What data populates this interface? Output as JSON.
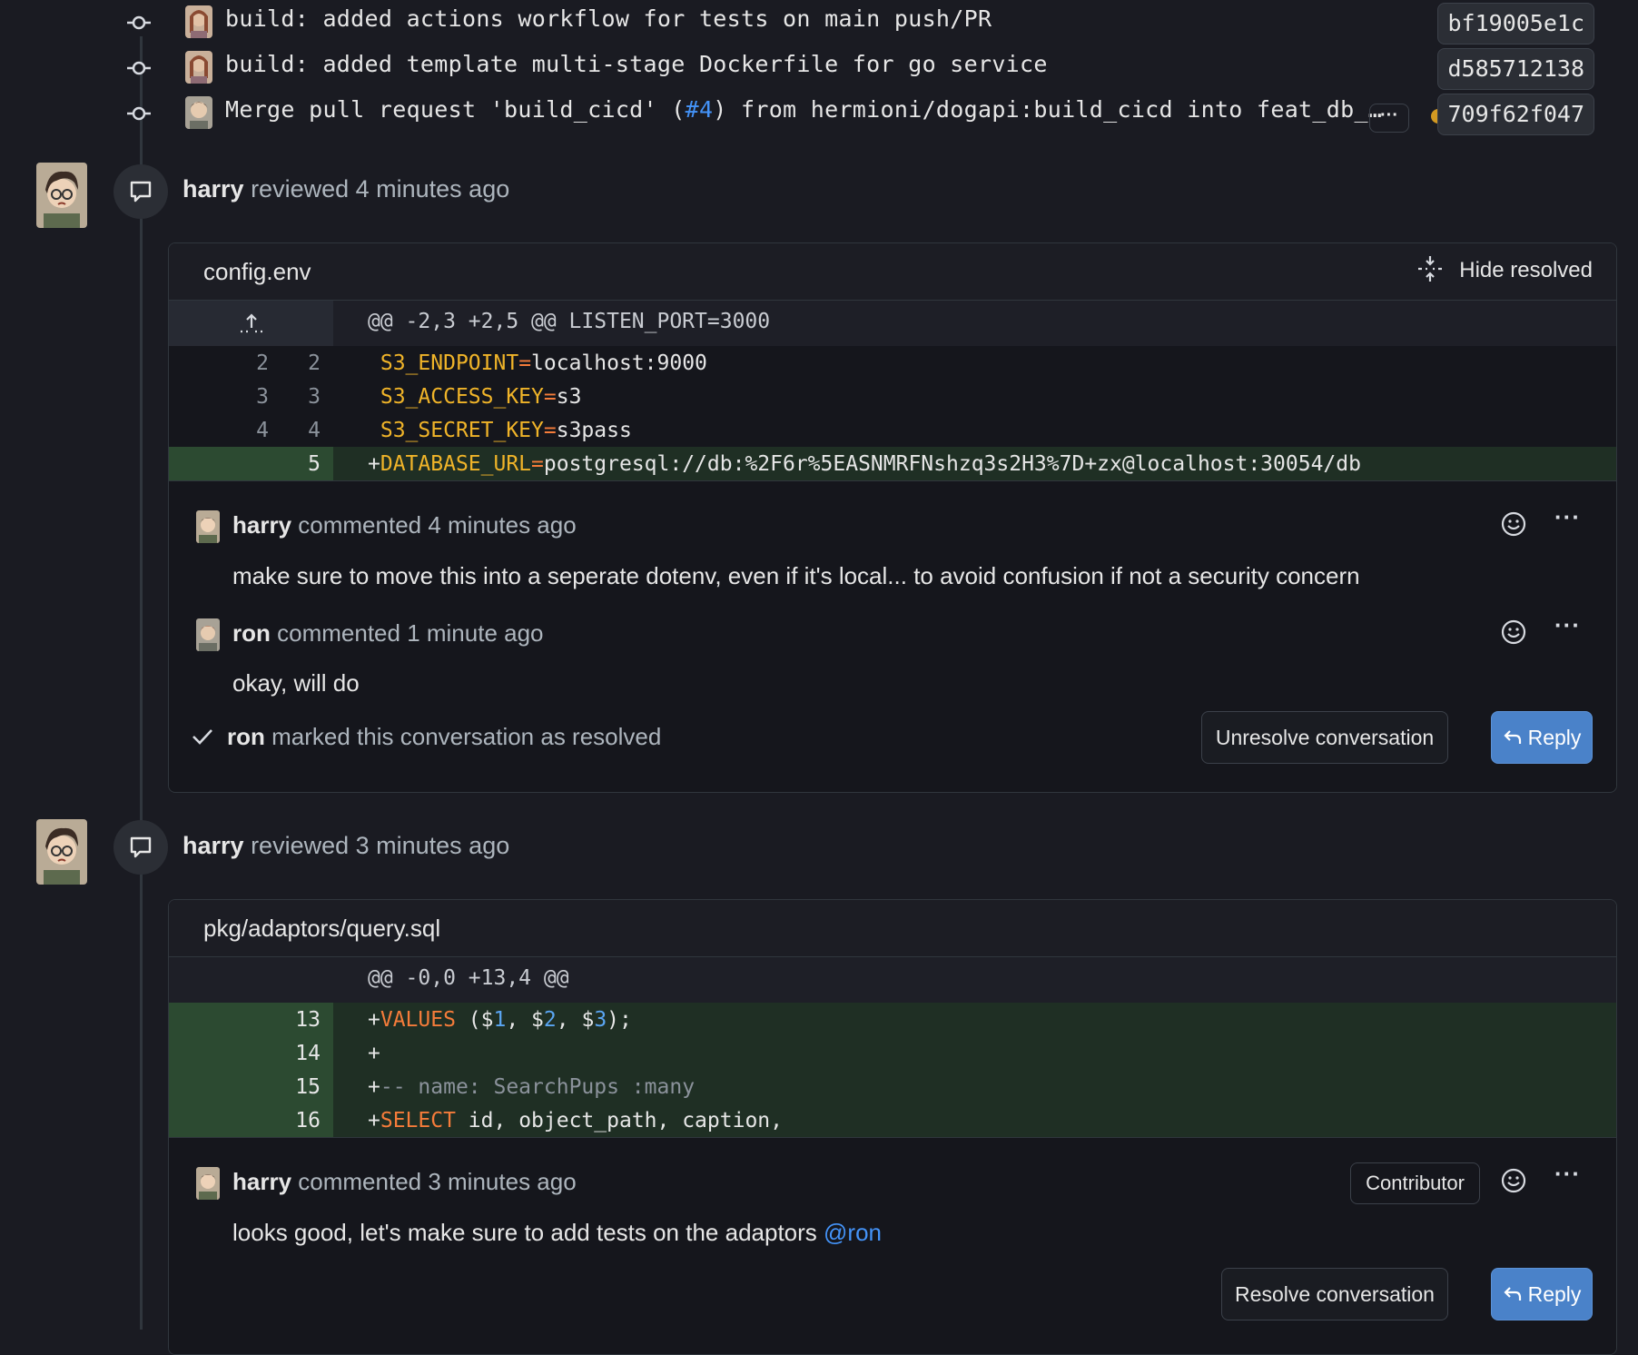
{
  "colors": {
    "background": "#1a1b22",
    "accent": "#4493f8",
    "added_line_bg": "#1f2f24",
    "pending_dot": "#d29922",
    "reply_button": "#4a82c9"
  },
  "commits": [
    {
      "message": "build: added actions workflow for tests on main push/PR",
      "sha": "bf19005e1c"
    },
    {
      "message": "build: added template multi-stage Dockerfile for go service",
      "sha": "d585712138"
    },
    {
      "message_prefix": "Merge pull request 'build_cicd' (",
      "message_link": "#4",
      "message_suffix": ") from hermioni/dogapi:build_cicd into feat_db_…",
      "more": "···",
      "sha": "709f62f047"
    }
  ],
  "reviews": [
    {
      "author": "harry",
      "action": "reviewed 4 minutes ago",
      "file": "config.env",
      "hide_resolved": "Hide resolved",
      "hunk": "@@ -2,3 +2,5 @@ LISTEN_PORT=3000",
      "lines": [
        {
          "old": "2",
          "new": "2",
          "key": "S3_ENDPOINT",
          "val": "localhost:9000"
        },
        {
          "old": "3",
          "new": "3",
          "key": "S3_ACCESS_KEY",
          "val": "s3"
        },
        {
          "old": "4",
          "new": "4",
          "key": "S3_SECRET_KEY",
          "val": "s3pass"
        },
        {
          "old": "",
          "new": "5",
          "key": "DATABASE_URL",
          "val": "postgresql://db:%2F6r%5EASNMRFNshzq3s2H3%7D+zx@localhost:30054/db",
          "added": true
        }
      ],
      "comments": [
        {
          "author": "harry",
          "meta": "commented 4 minutes ago",
          "body": "make sure to move this into a seperate dotenv, even if it's local... to avoid confusion if not a security concern"
        },
        {
          "author": "ron",
          "meta": "commented 1 minute ago",
          "body": "okay, will do"
        }
      ],
      "resolved_by": "ron",
      "resolved_text": "marked this conversation as resolved",
      "unresolve_label": "Unresolve conversation",
      "reply_label": "Reply"
    },
    {
      "author": "harry",
      "action": "reviewed 3 minutes ago",
      "file": "pkg/adaptors/query.sql",
      "hunk": "@@ -0,0 +13,4 @@",
      "lines": [
        {
          "new": "13",
          "text": "VALUES ($1, $2, $3);"
        },
        {
          "new": "14",
          "text": ""
        },
        {
          "new": "15",
          "text": "-- name: SearchPups :many"
        },
        {
          "new": "16",
          "text": "SELECT id, object_path, caption,"
        }
      ],
      "comment": {
        "author": "harry",
        "meta": "commented 3 minutes ago",
        "badge": "Contributor",
        "body": "looks good, let's make sure to add tests on the adaptors ",
        "mention": "@ron"
      },
      "resolve_label": "Resolve conversation",
      "reply_label": "Reply"
    }
  ]
}
